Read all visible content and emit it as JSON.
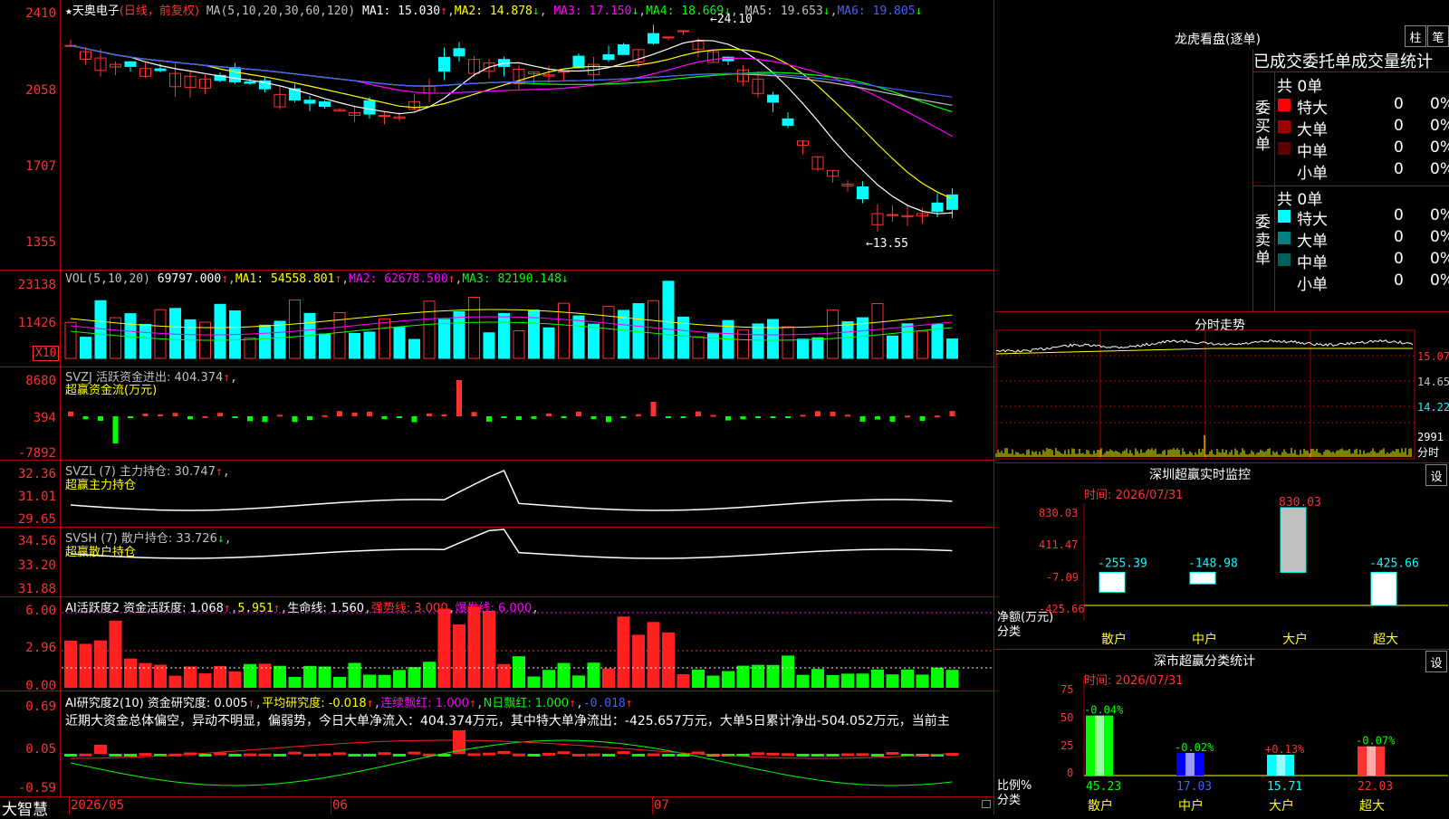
{
  "stock": {
    "name": "天奥电子",
    "star": "★",
    "period": "(日线，前复权)",
    "ma_label": "MA(5,10,20,30,60,120)",
    "ma1": "MA1: 15.030",
    "ma2": "MA2: 14.878",
    "ma3": "MA3: 17.150",
    "ma4": "MA4: 18.669",
    "ma5": "MA5: 19.653",
    "ma6": "MA6: 19.805",
    "high_label": "24.10",
    "low_label": "13.55",
    "price_ticks": [
      "2410",
      "2058",
      "1707",
      "1355"
    ]
  },
  "vol": {
    "header": "VOL(5,10,20)",
    "value": "69797.000",
    "ma1": "MA1: 54558.801",
    "ma2": "MA2: 62678.500",
    "ma3": "MA3: 82190.148",
    "ticks": [
      "23138",
      "11426"
    ],
    "unit": "X10"
  },
  "svzj": {
    "header": "SVZJ  活跃资金进出: 404.374",
    "sub": "超赢资金流(万元)",
    "ticks": [
      "8680",
      "394",
      "-7892"
    ]
  },
  "svzl": {
    "header": "SVZL (7) 主力持仓: 30.747",
    "sub": "超赢主力持仓",
    "ticks": [
      "32.36",
      "31.01",
      "29.65"
    ]
  },
  "svsh": {
    "header": "SVSH (7) 散户持仓: 33.726",
    "sub": "超赢散户持仓",
    "ticks": [
      "34.56",
      "33.20",
      "31.88"
    ]
  },
  "ai1": {
    "header": "AI活跃度2 资金活跃度: 1.068",
    "v2": "5.951",
    "life": "生命线: 1.560",
    "strong": "强势线: 3.000",
    "burst": "爆发线: 6.000",
    "ticks": [
      "6.00",
      "2.96",
      "0.00"
    ]
  },
  "ai2": {
    "header": "AI研究度2(10) 资金研究度: 0.005",
    "avg": "平均研究度: -0.018",
    "cont": "连续飘红: 1.000",
    "nday": "N日飘红: 1.000",
    "last": "-0.018",
    "commentary": "近期大资金总体偏空，异动不明显，偏弱势，今日大单净流入：404.374万元，其中特大单净流出：-425.657万元，大单5日累计净出-504.052万元，当前主",
    "ticks": [
      "0.69",
      "0.05",
      "-0.59"
    ]
  },
  "bottom_axis": {
    "brand": "大智慧",
    "dates": [
      "2026/05",
      "06",
      "07"
    ]
  },
  "lhb": {
    "title": "龙虎看盘(逐单)",
    "btn1": "柱",
    "btn2": "笔",
    "subtitle": "已成交委托单成交量统计",
    "buy_group": "委买单",
    "sell_group": "委卖单",
    "buy_total": "共 0单",
    "sell_total": "共 0单",
    "buy_rows": [
      {
        "label": "特大",
        "count": "0",
        "pct": "0%",
        "color": "#ff0000"
      },
      {
        "label": "大单",
        "count": "0",
        "pct": "0%",
        "color": "#a00000"
      },
      {
        "label": "中单",
        "count": "0",
        "pct": "0%",
        "color": "#600000"
      },
      {
        "label": "小单",
        "count": "0",
        "pct": "0%",
        "color": ""
      }
    ],
    "sell_rows": [
      {
        "label": "特大",
        "count": "0",
        "pct": "0%",
        "color": "#00ffff"
      },
      {
        "label": "大单",
        "count": "0",
        "pct": "0%",
        "color": "#008080"
      },
      {
        "label": "中单",
        "count": "0",
        "pct": "0%",
        "color": "#006060"
      },
      {
        "label": "小单",
        "count": "0",
        "pct": "0%",
        "color": ""
      }
    ]
  },
  "intraday": {
    "title": "分时走势",
    "ticks": [
      "15.07",
      "14.65",
      "14.22",
      "2991",
      "分时"
    ]
  },
  "monitor": {
    "title": "深圳超赢实时监控",
    "btn": "设",
    "time": "时间: 2026/07/31",
    "ticks": [
      "830.03",
      "411.47",
      "-7.09",
      "-425.66"
    ],
    "ylabel1": "净额(万元)",
    "ylabel2": "分类",
    "bars": [
      {
        "cat": "散户",
        "value": "-255.39"
      },
      {
        "cat": "中户",
        "value": "-148.98"
      },
      {
        "cat": "大户",
        "value": "830.03"
      },
      {
        "cat": "超大",
        "value": "-425.66"
      }
    ]
  },
  "classify": {
    "title": "深市超赢分类统计",
    "btn": "设",
    "time": "时间: 2026/07/31",
    "ticks": [
      "75",
      "50",
      "25",
      "0"
    ],
    "ylabel1": "比例%",
    "ylabel2": "分类",
    "bars": [
      {
        "cat": "散户",
        "pct": "45.23",
        "chg": "-0.04%"
      },
      {
        "cat": "中户",
        "pct": "17.03",
        "chg": "-0.02%"
      },
      {
        "cat": "大户",
        "pct": "15.71",
        "chg": "+0.13%"
      },
      {
        "cat": "超大",
        "pct": "22.03",
        "chg": "-0.07%"
      }
    ]
  }
}
